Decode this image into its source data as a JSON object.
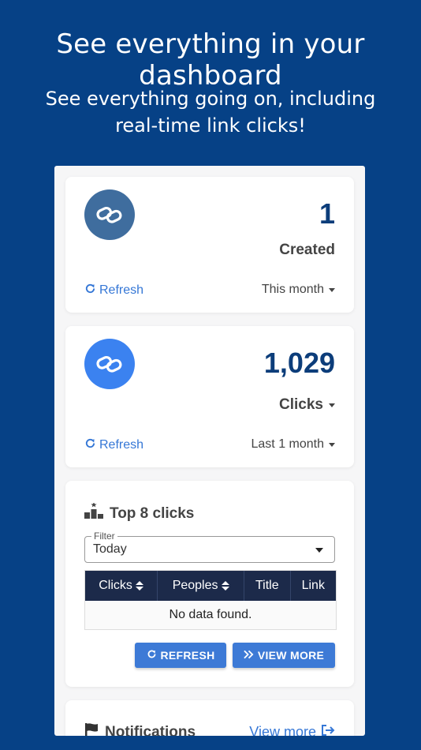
{
  "hero": {
    "title": "See everything in your dashboard",
    "subtitle_line1": "See everything going on, including",
    "subtitle_line2": "real-time link clicks!"
  },
  "created_card": {
    "value": "1",
    "label": "Created",
    "refresh_label": "Refresh",
    "period": "This month",
    "icon": "link-icon",
    "icon_bg": "#3f6d9e"
  },
  "clicks_card": {
    "value": "1,029",
    "label": "Clicks",
    "refresh_label": "Refresh",
    "period": "Last 1 month",
    "icon": "link-icon",
    "icon_bg": "#3b82f0"
  },
  "top_clicks": {
    "title": "Top 8 clicks",
    "icon": "podium-icon",
    "filter_label": "Filter",
    "filter_value": "Today",
    "columns": [
      "Clicks",
      "Peoples",
      "Title",
      "Link"
    ],
    "empty_text": "No data found.",
    "refresh_button": "REFRESH",
    "view_more_button": "VIEW MORE"
  },
  "notifications": {
    "title": "Notifications",
    "icon": "flag-icon",
    "view_more": "View more"
  },
  "colors": {
    "background": "#064186",
    "accent": "#3d7ad6",
    "number": "#0c3d7a",
    "table_header": "#1c2a4a"
  }
}
